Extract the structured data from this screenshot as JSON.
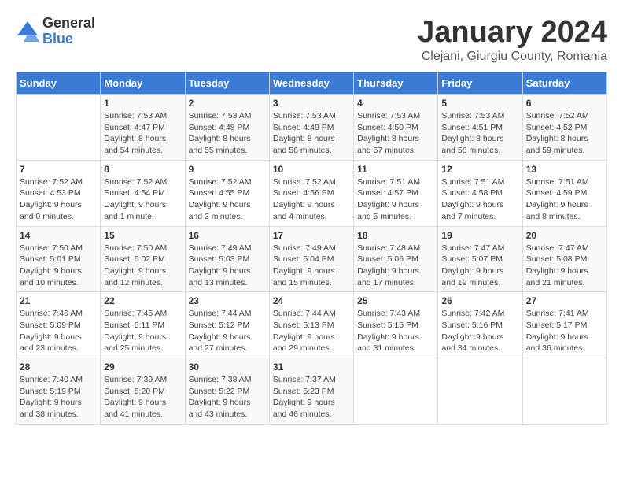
{
  "logo": {
    "general": "General",
    "blue": "Blue"
  },
  "title": "January 2024",
  "subtitle": "Clejani, Giurgiu County, Romania",
  "headers": [
    "Sunday",
    "Monday",
    "Tuesday",
    "Wednesday",
    "Thursday",
    "Friday",
    "Saturday"
  ],
  "weeks": [
    [
      {
        "day": "",
        "sunrise": "",
        "sunset": "",
        "daylight": ""
      },
      {
        "day": "1",
        "sunrise": "Sunrise: 7:53 AM",
        "sunset": "Sunset: 4:47 PM",
        "daylight": "Daylight: 8 hours and 54 minutes."
      },
      {
        "day": "2",
        "sunrise": "Sunrise: 7:53 AM",
        "sunset": "Sunset: 4:48 PM",
        "daylight": "Daylight: 8 hours and 55 minutes."
      },
      {
        "day": "3",
        "sunrise": "Sunrise: 7:53 AM",
        "sunset": "Sunset: 4:49 PM",
        "daylight": "Daylight: 8 hours and 56 minutes."
      },
      {
        "day": "4",
        "sunrise": "Sunrise: 7:53 AM",
        "sunset": "Sunset: 4:50 PM",
        "daylight": "Daylight: 8 hours and 57 minutes."
      },
      {
        "day": "5",
        "sunrise": "Sunrise: 7:53 AM",
        "sunset": "Sunset: 4:51 PM",
        "daylight": "Daylight: 8 hours and 58 minutes."
      },
      {
        "day": "6",
        "sunrise": "Sunrise: 7:52 AM",
        "sunset": "Sunset: 4:52 PM",
        "daylight": "Daylight: 8 hours and 59 minutes."
      }
    ],
    [
      {
        "day": "7",
        "sunrise": "Sunrise: 7:52 AM",
        "sunset": "Sunset: 4:53 PM",
        "daylight": "Daylight: 9 hours and 0 minutes."
      },
      {
        "day": "8",
        "sunrise": "Sunrise: 7:52 AM",
        "sunset": "Sunset: 4:54 PM",
        "daylight": "Daylight: 9 hours and 1 minute."
      },
      {
        "day": "9",
        "sunrise": "Sunrise: 7:52 AM",
        "sunset": "Sunset: 4:55 PM",
        "daylight": "Daylight: 9 hours and 3 minutes."
      },
      {
        "day": "10",
        "sunrise": "Sunrise: 7:52 AM",
        "sunset": "Sunset: 4:56 PM",
        "daylight": "Daylight: 9 hours and 4 minutes."
      },
      {
        "day": "11",
        "sunrise": "Sunrise: 7:51 AM",
        "sunset": "Sunset: 4:57 PM",
        "daylight": "Daylight: 9 hours and 5 minutes."
      },
      {
        "day": "12",
        "sunrise": "Sunrise: 7:51 AM",
        "sunset": "Sunset: 4:58 PM",
        "daylight": "Daylight: 9 hours and 7 minutes."
      },
      {
        "day": "13",
        "sunrise": "Sunrise: 7:51 AM",
        "sunset": "Sunset: 4:59 PM",
        "daylight": "Daylight: 9 hours and 8 minutes."
      }
    ],
    [
      {
        "day": "14",
        "sunrise": "Sunrise: 7:50 AM",
        "sunset": "Sunset: 5:01 PM",
        "daylight": "Daylight: 9 hours and 10 minutes."
      },
      {
        "day": "15",
        "sunrise": "Sunrise: 7:50 AM",
        "sunset": "Sunset: 5:02 PM",
        "daylight": "Daylight: 9 hours and 12 minutes."
      },
      {
        "day": "16",
        "sunrise": "Sunrise: 7:49 AM",
        "sunset": "Sunset: 5:03 PM",
        "daylight": "Daylight: 9 hours and 13 minutes."
      },
      {
        "day": "17",
        "sunrise": "Sunrise: 7:49 AM",
        "sunset": "Sunset: 5:04 PM",
        "daylight": "Daylight: 9 hours and 15 minutes."
      },
      {
        "day": "18",
        "sunrise": "Sunrise: 7:48 AM",
        "sunset": "Sunset: 5:06 PM",
        "daylight": "Daylight: 9 hours and 17 minutes."
      },
      {
        "day": "19",
        "sunrise": "Sunrise: 7:47 AM",
        "sunset": "Sunset: 5:07 PM",
        "daylight": "Daylight: 9 hours and 19 minutes."
      },
      {
        "day": "20",
        "sunrise": "Sunrise: 7:47 AM",
        "sunset": "Sunset: 5:08 PM",
        "daylight": "Daylight: 9 hours and 21 minutes."
      }
    ],
    [
      {
        "day": "21",
        "sunrise": "Sunrise: 7:46 AM",
        "sunset": "Sunset: 5:09 PM",
        "daylight": "Daylight: 9 hours and 23 minutes."
      },
      {
        "day": "22",
        "sunrise": "Sunrise: 7:45 AM",
        "sunset": "Sunset: 5:11 PM",
        "daylight": "Daylight: 9 hours and 25 minutes."
      },
      {
        "day": "23",
        "sunrise": "Sunrise: 7:44 AM",
        "sunset": "Sunset: 5:12 PM",
        "daylight": "Daylight: 9 hours and 27 minutes."
      },
      {
        "day": "24",
        "sunrise": "Sunrise: 7:44 AM",
        "sunset": "Sunset: 5:13 PM",
        "daylight": "Daylight: 9 hours and 29 minutes."
      },
      {
        "day": "25",
        "sunrise": "Sunrise: 7:43 AM",
        "sunset": "Sunset: 5:15 PM",
        "daylight": "Daylight: 9 hours and 31 minutes."
      },
      {
        "day": "26",
        "sunrise": "Sunrise: 7:42 AM",
        "sunset": "Sunset: 5:16 PM",
        "daylight": "Daylight: 9 hours and 34 minutes."
      },
      {
        "day": "27",
        "sunrise": "Sunrise: 7:41 AM",
        "sunset": "Sunset: 5:17 PM",
        "daylight": "Daylight: 9 hours and 36 minutes."
      }
    ],
    [
      {
        "day": "28",
        "sunrise": "Sunrise: 7:40 AM",
        "sunset": "Sunset: 5:19 PM",
        "daylight": "Daylight: 9 hours and 38 minutes."
      },
      {
        "day": "29",
        "sunrise": "Sunrise: 7:39 AM",
        "sunset": "Sunset: 5:20 PM",
        "daylight": "Daylight: 9 hours and 41 minutes."
      },
      {
        "day": "30",
        "sunrise": "Sunrise: 7:38 AM",
        "sunset": "Sunset: 5:22 PM",
        "daylight": "Daylight: 9 hours and 43 minutes."
      },
      {
        "day": "31",
        "sunrise": "Sunrise: 7:37 AM",
        "sunset": "Sunset: 5:23 PM",
        "daylight": "Daylight: 9 hours and 46 minutes."
      },
      {
        "day": "",
        "sunrise": "",
        "sunset": "",
        "daylight": ""
      },
      {
        "day": "",
        "sunrise": "",
        "sunset": "",
        "daylight": ""
      },
      {
        "day": "",
        "sunrise": "",
        "sunset": "",
        "daylight": ""
      }
    ]
  ]
}
